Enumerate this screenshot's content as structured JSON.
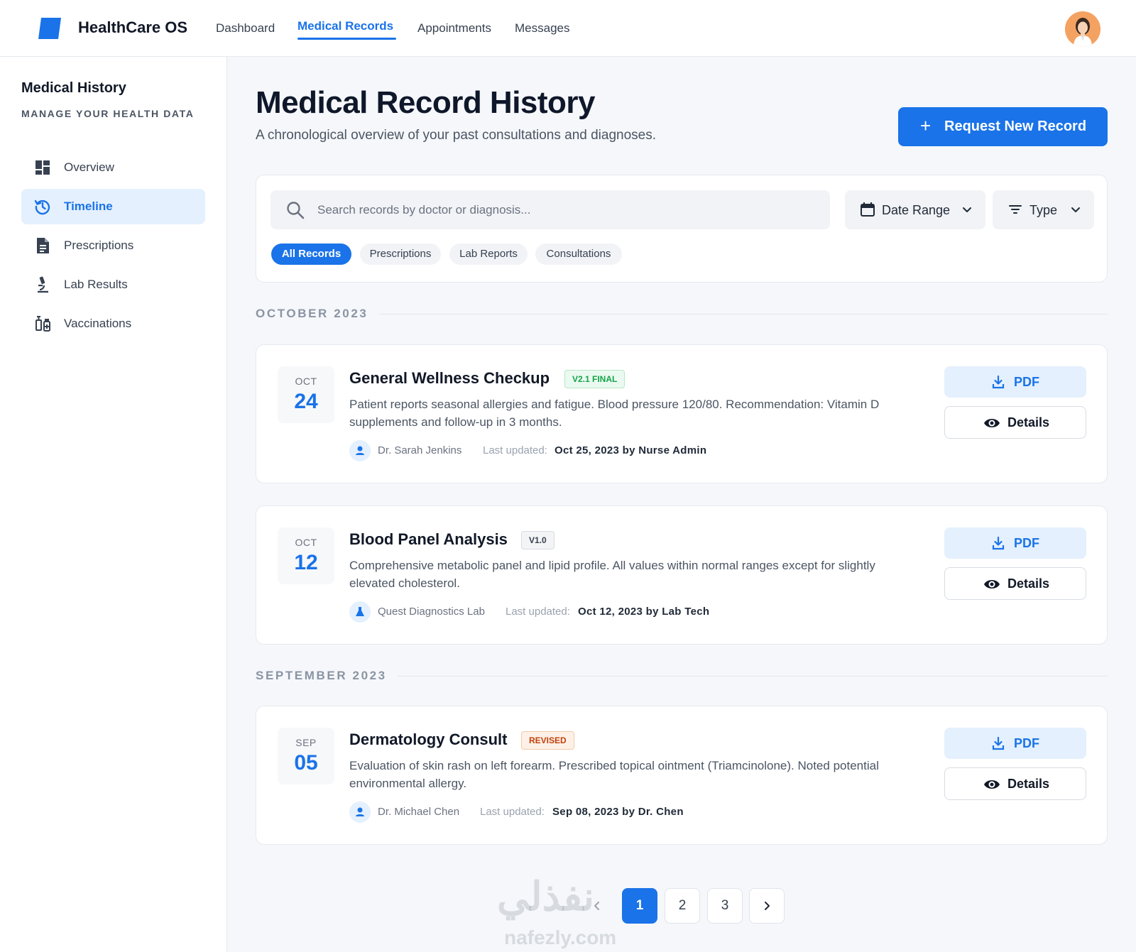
{
  "app": {
    "brand": "HealthCare OS"
  },
  "nav": {
    "items": [
      {
        "label": "Dashboard"
      },
      {
        "label": "Medical Records",
        "active": true
      },
      {
        "label": "Appointments"
      },
      {
        "label": "Messages"
      }
    ]
  },
  "sidebar": {
    "title": "Medical History",
    "subtitle": "MANAGE YOUR HEALTH DATA",
    "items": [
      {
        "label": "Overview",
        "icon": "dashboard-icon"
      },
      {
        "label": "Timeline",
        "icon": "history-icon",
        "active": true
      },
      {
        "label": "Prescriptions",
        "icon": "document-icon"
      },
      {
        "label": "Lab Results",
        "icon": "microscope-icon"
      },
      {
        "label": "Vaccinations",
        "icon": "vaccine-icon"
      }
    ]
  },
  "header": {
    "title": "Medical Record History",
    "subtitle": "A chronological overview of your past consultations and diagnoses.",
    "request_button": "Request New Record"
  },
  "filters": {
    "search_placeholder": "Search records by doctor or diagnosis...",
    "date_range": "Date Range",
    "type": "Type",
    "chips": [
      "All Records",
      "Prescriptions",
      "Lab Reports",
      "Consultations"
    ],
    "active_chip": "All Records"
  },
  "sections": [
    {
      "label": "OCTOBER 2023"
    },
    {
      "label": "SEPTEMBER 2023"
    }
  ],
  "records": [
    {
      "month": "OCT",
      "day": "24",
      "title": "General Wellness Checkup",
      "badge": "V2.1 FINAL",
      "description": "Patient reports seasonal allergies and fatigue. Blood pressure 120/80. Recommendation: Vitamin D supplements and follow-up in 3 months.",
      "author": "Dr. Sarah Jenkins",
      "updated_label": "Last updated:",
      "updated_by": "Oct 25, 2023 by Nurse Admin",
      "pdf_label": "PDF",
      "details_label": "Details"
    },
    {
      "month": "OCT",
      "day": "12",
      "title": "Blood Panel Analysis",
      "badge": "V1.0",
      "description": "Comprehensive metabolic panel and lipid profile. All values within normal ranges except for slightly elevated cholesterol.",
      "author": "Quest Diagnostics Lab",
      "updated_label": "Last updated:",
      "updated_by": "Oct 12, 2023 by Lab Tech",
      "pdf_label": "PDF",
      "details_label": "Details"
    },
    {
      "month": "SEP",
      "day": "05",
      "title": "Dermatology Consult",
      "badge": "REVISED",
      "description": "Evaluation of skin rash on left forearm. Prescribed topical ointment (Triamcinolone). Noted potential environmental allergy.",
      "author": "Dr. Michael Chen",
      "updated_label": "Last updated:",
      "updated_by": "Sep 08, 2023 by Dr. Chen",
      "pdf_label": "PDF",
      "details_label": "Details"
    }
  ],
  "pagination": {
    "pages": [
      "1",
      "2",
      "3"
    ],
    "current": "1"
  },
  "watermark": {
    "line1": "نفذلي",
    "line2": "nafezly.com"
  },
  "colors": {
    "accent": "#1a73e8",
    "badge_final": "#16a34a",
    "badge_revised": "#c2410c"
  }
}
